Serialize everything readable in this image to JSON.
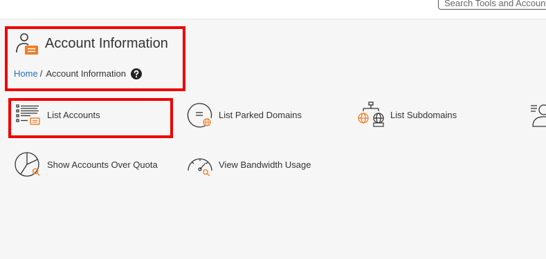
{
  "search": {
    "placeholder": "Search Tools and Accounts"
  },
  "page": {
    "title": "Account Information",
    "breadcrumb": {
      "home": "Home",
      "separator": "/",
      "current": "Account Information"
    }
  },
  "tools": [
    {
      "label": "List Accounts",
      "icon": "list-accounts-icon"
    },
    {
      "label": "List Parked Domains",
      "icon": "parked-domains-icon"
    },
    {
      "label": "List Subdomains",
      "icon": "subdomains-icon"
    },
    {
      "label": "",
      "icon": "user-list-icon"
    },
    {
      "label": "Show Accounts Over Quota",
      "icon": "quota-pie-icon"
    },
    {
      "label": "View Bandwidth Usage",
      "icon": "speedometer-icon"
    }
  ],
  "colors": {
    "accent": "#f47c20",
    "link": "#1f72c4",
    "highlight": "#ee0000"
  }
}
